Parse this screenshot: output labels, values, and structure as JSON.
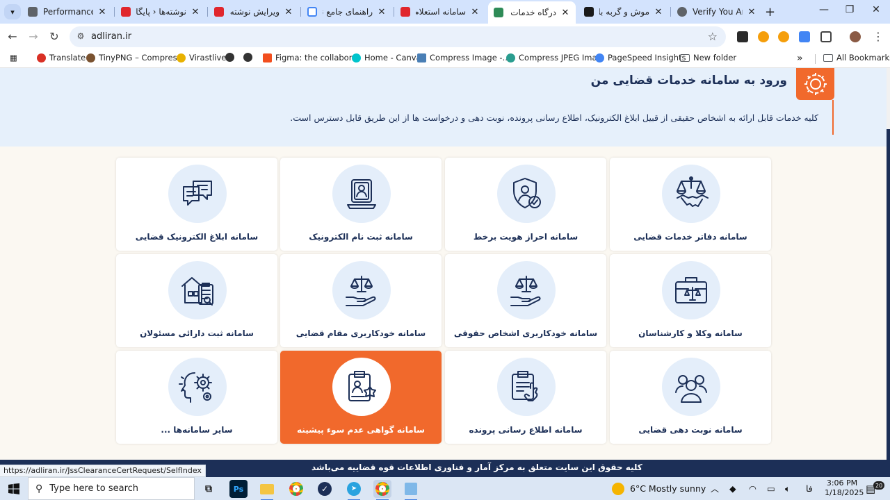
{
  "browser": {
    "tabs": [
      {
        "title": "Performance",
        "favicon": "#5f6368",
        "dir": "ltr"
      },
      {
        "title": "نوشته‌ها ‹ پایگاه ...",
        "favicon": "#e0262d",
        "dir": "rtl"
      },
      {
        "title": "ویرایش نوشته \"را...",
        "favicon": "#e0262d",
        "dir": "rtl"
      },
      {
        "title": "راهنمای جامع نحو...",
        "favicon": "#4285f4",
        "dir": "rtl"
      },
      {
        "title": "سامانه استعلام ...",
        "favicon": "#e0262d",
        "dir": "rtl"
      },
      {
        "title": "درگاه خدمات الکترونیک",
        "favicon": "#2e8b57",
        "dir": "rtl",
        "active": true
      },
      {
        "title": "موش و گربه بازی ...",
        "favicon": "#1a1a1a",
        "dir": "rtl"
      },
      {
        "title": "Verify You Are Human",
        "favicon": "#5f6368",
        "dir": "ltr"
      }
    ],
    "url": "adliran.ir",
    "bookmarks": [
      {
        "label": "Translate",
        "color": "#d93025"
      },
      {
        "label": "TinyPNG – Compres...",
        "color": "#7a5230"
      },
      {
        "label": "Virastlive",
        "color": "#e8b100"
      },
      {
        "label": "",
        "color": "#333333"
      },
      {
        "label": "",
        "color": "#333333"
      },
      {
        "label": "Figma: the collabor...",
        "color": "#f24e1e"
      },
      {
        "label": "Home - Canva",
        "color": "#00c4cc"
      },
      {
        "label": "Compress Image -...",
        "color": "#4a7fb5"
      },
      {
        "label": "Compress JPEG Ima...",
        "color": "#2a9d8f"
      },
      {
        "label": "PageSpeed Insights",
        "color": "#4285f4"
      },
      {
        "label": "New folder",
        "color": "#5f6368"
      },
      {
        "label": "All Bookmarks",
        "color": "#5f6368"
      }
    ],
    "status_url": "https://adliran.ir/JssClearanceCertRequest/SelfIndex"
  },
  "hero": {
    "title": "ورود به سامانه خدمات قضایی من",
    "description": "کلیه خدمات قابل ارائه به اشخاص حقیقی از قبیل ابلاغ الکترونیک، اطلاع رسانی پرونده، نوبت دهی و درخواست ها از این طریق قابل دسترس است."
  },
  "services": [
    {
      "label": "سامانه دفاتر خدمات قضایی",
      "icon": "scales-handshake-icon"
    },
    {
      "label": "سامانه احراز هویت برخط",
      "icon": "shield-check-icon"
    },
    {
      "label": "سامانه ثبت نام الکترونیک",
      "icon": "laptop-user-icon"
    },
    {
      "label": "سامانه ابلاغ الکترونیک قضایی",
      "icon": "chat-bubbles-icon"
    },
    {
      "label": "سامانه وکلا و کارشناسان",
      "icon": "briefcase-scales-icon"
    },
    {
      "label": "سامانه خودکاربری اشخاص حقوقی",
      "icon": "hand-scales-icon"
    },
    {
      "label": "سامانه خودکاربری مقام قضایی",
      "icon": "hand-scales-icon"
    },
    {
      "label": "سامانه ثبت دارائی مسئولان",
      "icon": "building-clipboard-icon"
    },
    {
      "label": "سامانه نوبت دهی قضایی",
      "icon": "people-group-icon"
    },
    {
      "label": "سامانه اطلاع رسانی پرونده",
      "icon": "clipboard-touch-icon"
    },
    {
      "label": "سامانه گواهی عدم سوء پیشینه",
      "icon": "clipboard-badge-icon",
      "active": true
    },
    {
      "label": "سایر سامانه‌ها ...",
      "icon": "head-gears-icon"
    }
  ],
  "footer": {
    "text": "کلیه حقوق این سایت متعلق به مرکز آمار و فناوری اطلاعات قوه قضاییه می‌باشد"
  },
  "taskbar": {
    "search_placeholder": "Type here to search",
    "weather": "6°C  Mostly sunny",
    "language": "فا",
    "time": "3:06 PM",
    "date": "1/18/2025",
    "notification_count": "20"
  },
  "colors": {
    "accent": "#f1692c",
    "navy": "#1c2f57",
    "hero_bg": "#e6f0fb",
    "circle_bg": "#e4eefa"
  }
}
